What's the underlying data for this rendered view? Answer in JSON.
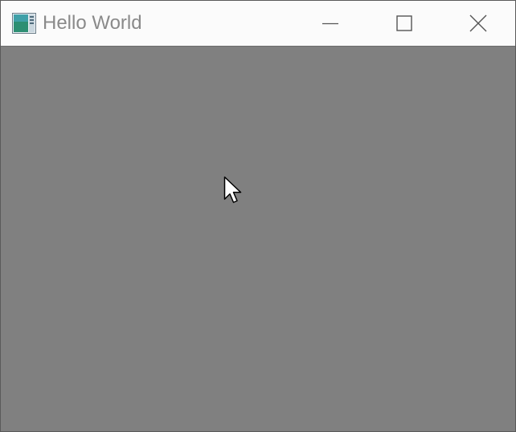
{
  "window": {
    "title": "Hello World",
    "app_icon": "app-window-icon",
    "controls": {
      "minimize": "minimize-icon",
      "maximize": "maximize-icon",
      "close": "close-icon"
    }
  },
  "colors": {
    "titlebar": "#fbfbfb",
    "title_text": "#8a8a8a",
    "client_background": "#808080"
  },
  "cursor": {
    "icon": "mouse-pointer-icon"
  }
}
